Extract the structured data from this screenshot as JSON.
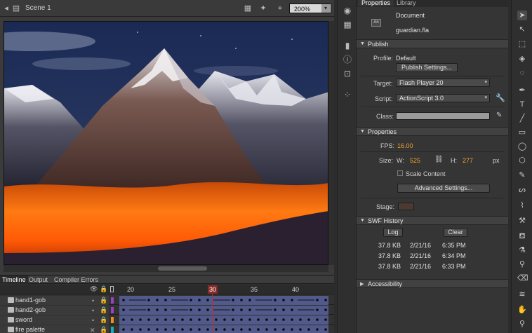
{
  "stage_toolbar": {
    "scene_label": "Scene 1",
    "zoom_value": "200%"
  },
  "timeline": {
    "tabs": [
      "Timeline",
      "Output",
      "Compiler Errors"
    ],
    "ruler_numbers": [
      "20",
      "25",
      "30",
      "35",
      "40"
    ],
    "current_frame": "30",
    "layers": [
      {
        "name": "hand1-gob",
        "color": "#9a40c8"
      },
      {
        "name": "hand2-gob",
        "color": "#9a40c8"
      },
      {
        "name": "sword",
        "color": "#f08c1a"
      },
      {
        "name": "fire palette",
        "color": "#18b0b0"
      }
    ]
  },
  "properties": {
    "tabs": [
      "Properties",
      "Library"
    ],
    "doc_icon_text": "An",
    "doc_type": "Document",
    "doc_name": "guardian.fla",
    "publish": {
      "section_title": "Publish",
      "profile_label": "Profile:",
      "profile_value": "Default",
      "publish_settings_button": "Publish Settings...",
      "target_label": "Target:",
      "target_value": "Flash Player 20",
      "script_label": "Script:",
      "script_value": "ActionScript 3.0",
      "class_label": "Class:"
    },
    "props": {
      "section_title": "Properties",
      "fps_label": "FPS:",
      "fps_value": "16.00",
      "size_label": "Size:",
      "w_label": "W:",
      "w_value": "525",
      "h_label": "H:",
      "h_value": "277",
      "unit": "px",
      "scale_content_label": "Scale Content",
      "advanced_button": "Advanced Settings...",
      "stage_label": "Stage:",
      "stage_color": "#4a3a30"
    },
    "swf": {
      "section_title": "SWF History",
      "log_button": "Log",
      "clear_button": "Clear",
      "entries": [
        {
          "size": "37.8 KB",
          "date": "2/21/16",
          "time": "6:35 PM"
        },
        {
          "size": "37.8 KB",
          "date": "2/21/16",
          "time": "6:34 PM"
        },
        {
          "size": "37.8 KB",
          "date": "2/21/16",
          "time": "6:33 PM"
        }
      ]
    },
    "accessibility": {
      "section_title": "Accessibility"
    }
  },
  "colors": {
    "accent_orange": "#f0a030",
    "playhead": "#c03030",
    "frame_span": "#525a8c"
  }
}
